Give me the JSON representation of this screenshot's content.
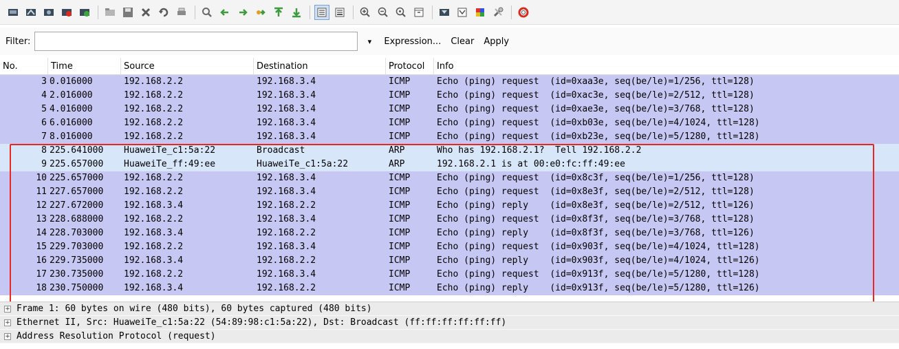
{
  "toolbar": {
    "icons": [
      "interfaces-icon",
      "options-icon",
      "start-capture-icon",
      "stop-capture-icon",
      "restart-capture-icon",
      "open-icon",
      "save-icon",
      "close-icon",
      "reload-icon",
      "print-icon",
      "find-icon",
      "back-icon",
      "forward-icon",
      "goto-icon",
      "first-packet-icon",
      "last-packet-icon",
      "colorize-icon",
      "autoscroll-icon",
      "zoom-in-icon",
      "zoom-out-icon",
      "normal-size-icon",
      "resize-columns-icon",
      "capture-filters-icon",
      "display-filters-icon",
      "coloring-rules-icon",
      "preferences-icon",
      "help-icon"
    ]
  },
  "filter": {
    "label": "Filter:",
    "value": "",
    "dropdown": "▾",
    "expression_label": "Expression...",
    "clear_label": "Clear",
    "apply_label": "Apply"
  },
  "packet_list": {
    "headers": {
      "no": "No.",
      "time": "Time",
      "source": "Source",
      "destination": "Destination",
      "protocol": "Protocol",
      "info": "Info"
    },
    "rows": [
      {
        "no": "3",
        "time": "0.016000",
        "source": "192.168.2.2",
        "destination": "192.168.3.4",
        "protocol": "ICMP",
        "info": "Echo (ping) request  (id=0xaa3e, seq(be/le)=1/256, ttl=128)"
      },
      {
        "no": "4",
        "time": "2.016000",
        "source": "192.168.2.2",
        "destination": "192.168.3.4",
        "protocol": "ICMP",
        "info": "Echo (ping) request  (id=0xac3e, seq(be/le)=2/512, ttl=128)"
      },
      {
        "no": "5",
        "time": "4.016000",
        "source": "192.168.2.2",
        "destination": "192.168.3.4",
        "protocol": "ICMP",
        "info": "Echo (ping) request  (id=0xae3e, seq(be/le)=3/768, ttl=128)"
      },
      {
        "no": "6",
        "time": "6.016000",
        "source": "192.168.2.2",
        "destination": "192.168.3.4",
        "protocol": "ICMP",
        "info": "Echo (ping) request  (id=0xb03e, seq(be/le)=4/1024, ttl=128)"
      },
      {
        "no": "7",
        "time": "8.016000",
        "source": "192.168.2.2",
        "destination": "192.168.3.4",
        "protocol": "ICMP",
        "info": "Echo (ping) request  (id=0xb23e, seq(be/le)=5/1280, ttl=128)"
      },
      {
        "no": "8",
        "time": "225.641000",
        "source": "HuaweiTe_c1:5a:22",
        "destination": "Broadcast",
        "protocol": "ARP",
        "info": "Who has 192.168.2.1?  Tell 192.168.2.2"
      },
      {
        "no": "9",
        "time": "225.657000",
        "source": "HuaweiTe_ff:49:ee",
        "destination": "HuaweiTe_c1:5a:22",
        "protocol": "ARP",
        "info": "192.168.2.1 is at 00:e0:fc:ff:49:ee"
      },
      {
        "no": "10",
        "time": "225.657000",
        "source": "192.168.2.2",
        "destination": "192.168.3.4",
        "protocol": "ICMP",
        "info": "Echo (ping) request  (id=0x8c3f, seq(be/le)=1/256, ttl=128)"
      },
      {
        "no": "11",
        "time": "227.657000",
        "source": "192.168.2.2",
        "destination": "192.168.3.4",
        "protocol": "ICMP",
        "info": "Echo (ping) request  (id=0x8e3f, seq(be/le)=2/512, ttl=128)"
      },
      {
        "no": "12",
        "time": "227.672000",
        "source": "192.168.3.4",
        "destination": "192.168.2.2",
        "protocol": "ICMP",
        "info": "Echo (ping) reply    (id=0x8e3f, seq(be/le)=2/512, ttl=126)"
      },
      {
        "no": "13",
        "time": "228.688000",
        "source": "192.168.2.2",
        "destination": "192.168.3.4",
        "protocol": "ICMP",
        "info": "Echo (ping) request  (id=0x8f3f, seq(be/le)=3/768, ttl=128)"
      },
      {
        "no": "14",
        "time": "228.703000",
        "source": "192.168.3.4",
        "destination": "192.168.2.2",
        "protocol": "ICMP",
        "info": "Echo (ping) reply    (id=0x8f3f, seq(be/le)=3/768, ttl=126)"
      },
      {
        "no": "15",
        "time": "229.703000",
        "source": "192.168.2.2",
        "destination": "192.168.3.4",
        "protocol": "ICMP",
        "info": "Echo (ping) request  (id=0x903f, seq(be/le)=4/1024, ttl=128)"
      },
      {
        "no": "16",
        "time": "229.735000",
        "source": "192.168.3.4",
        "destination": "192.168.2.2",
        "protocol": "ICMP",
        "info": "Echo (ping) reply    (id=0x903f, seq(be/le)=4/1024, ttl=126)"
      },
      {
        "no": "17",
        "time": "230.735000",
        "source": "192.168.2.2",
        "destination": "192.168.3.4",
        "protocol": "ICMP",
        "info": "Echo (ping) request  (id=0x913f, seq(be/le)=5/1280, ttl=128)"
      },
      {
        "no": "18",
        "time": "230.750000",
        "source": "192.168.3.4",
        "destination": "192.168.2.2",
        "protocol": "ICMP",
        "info": "Echo (ping) reply    (id=0x913f, seq(be/le)=5/1280, ttl=126)"
      }
    ]
  },
  "details": {
    "rows": [
      {
        "expander": "+",
        "text": "Frame 1: 60 bytes on wire (480 bits), 60 bytes captured (480 bits)"
      },
      {
        "expander": "+",
        "text": "Ethernet II, Src: HuaweiTe_c1:5a:22 (54:89:98:c1:5a:22), Dst: Broadcast (ff:ff:ff:ff:ff:ff)"
      },
      {
        "expander": "+",
        "text": "Address Resolution Protocol (request)"
      }
    ]
  },
  "colors": {
    "icmp_row": "#c7c7f3",
    "arp_row": "#d7e6f9",
    "highlight": "#e8281f"
  }
}
